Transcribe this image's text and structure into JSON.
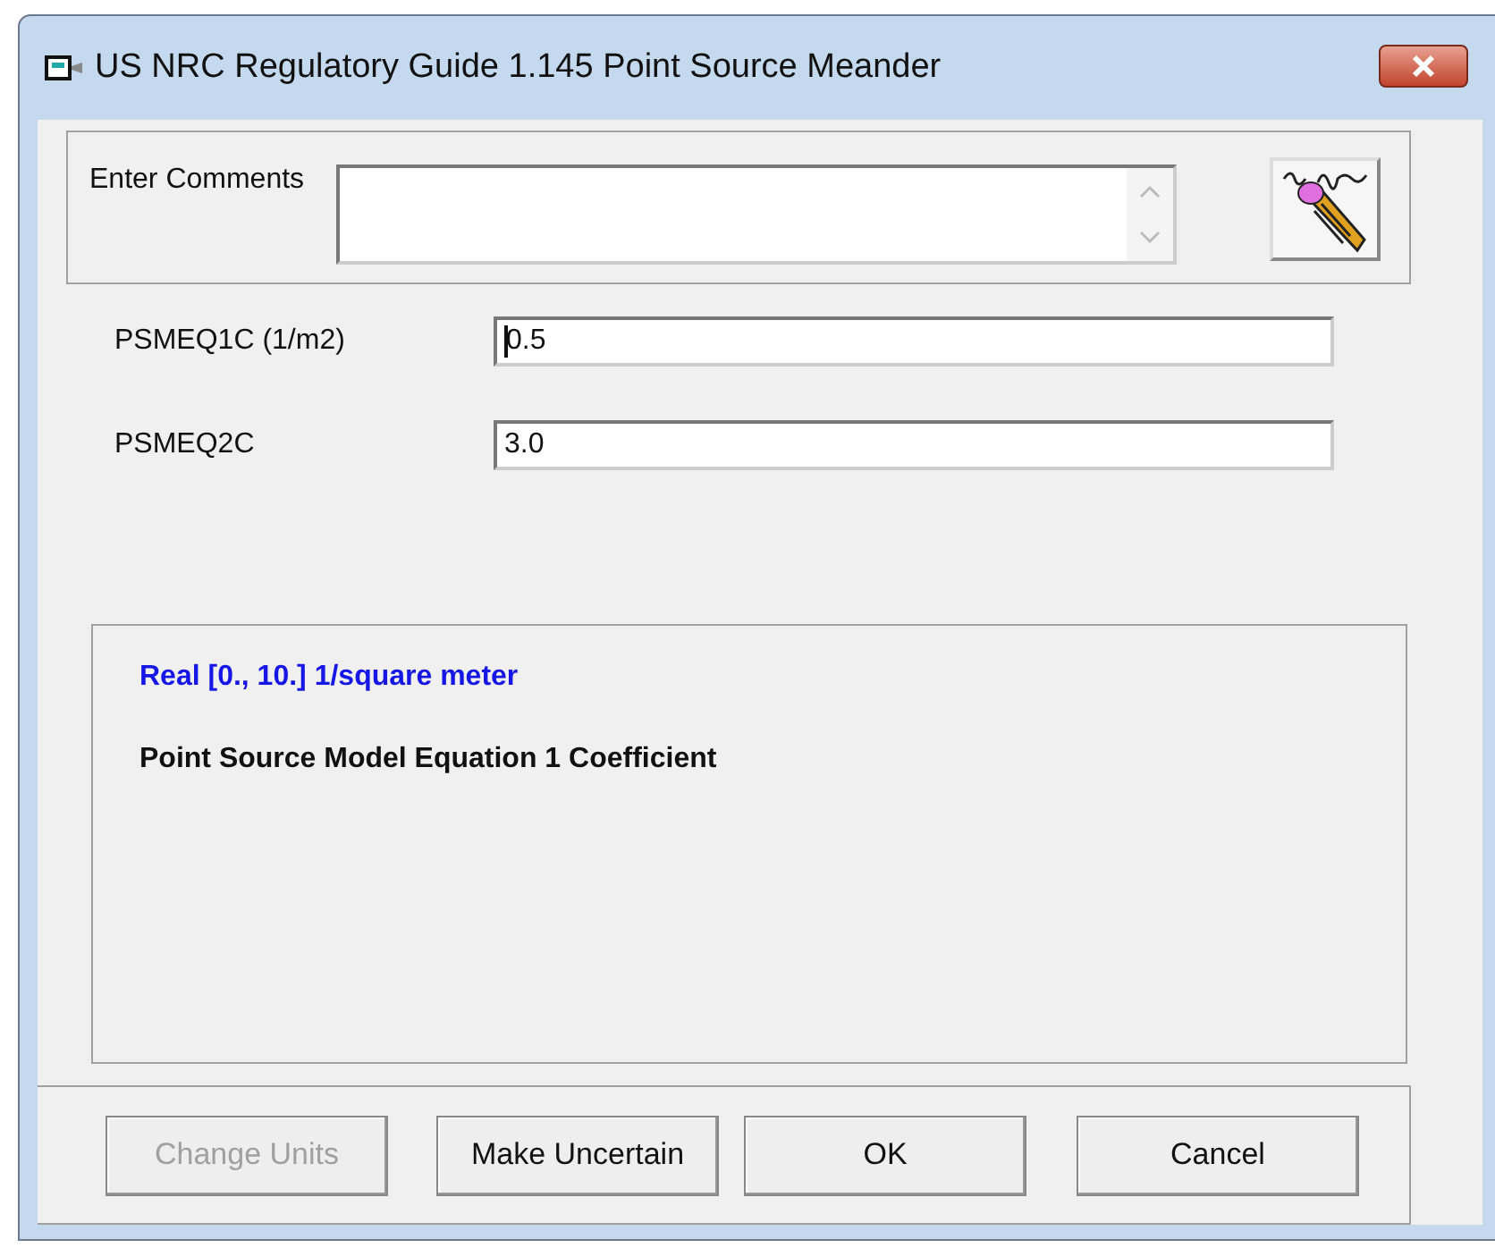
{
  "window": {
    "title": "US NRC Regulatory Guide 1.145 Point Source Meander"
  },
  "comments": {
    "label": "Enter Comments"
  },
  "fields": [
    {
      "label": "PSMEQ1C (1/m2)",
      "value": "0.5",
      "focused": true
    },
    {
      "label": "PSMEQ2C",
      "value": "3.0",
      "focused": false
    }
  ],
  "info": {
    "range": "Real [0., 10.]  1/square meter",
    "description": "Point Source Model Equation 1 Coefficient"
  },
  "buttons": [
    {
      "label": "Change Units",
      "disabled": true
    },
    {
      "label": "Make Uncertain",
      "disabled": false
    },
    {
      "label": "OK",
      "disabled": false
    },
    {
      "label": "Cancel",
      "disabled": false
    }
  ]
}
